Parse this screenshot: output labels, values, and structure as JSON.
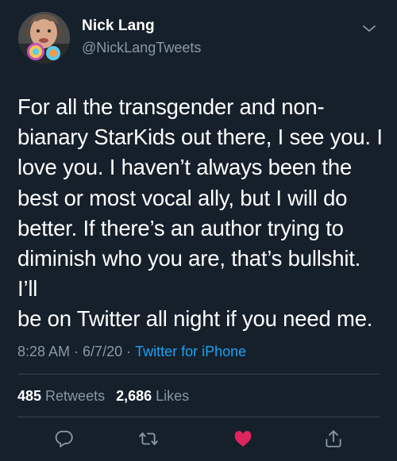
{
  "colors": {
    "background": "#15202b",
    "primary_text": "#ffffff",
    "secondary_text": "#8899a6",
    "accent": "#1da1f2",
    "like": "#e0245e",
    "divider": "#38444d"
  },
  "tweet": {
    "author": {
      "name": "Nick Lang",
      "handle": "@NickLangTweets",
      "avatar_icon": "avatar-photo"
    },
    "menu_icon": "chevron-down-icon",
    "text": "For all the transgender and non-\nbianary StarKids out there, I see you. I\nlove you. I haven’t always been the\nbest or most vocal ally, but I will do\nbetter. If there’s an author trying to\ndiminish who you are, that’s bullshit. I’ll\nbe on Twitter all night if you need me.",
    "time": "8:28 AM",
    "separator": "·",
    "date": "6/7/20",
    "source": "Twitter for iPhone",
    "stats": {
      "retweets_count": "485",
      "retweets_label": "Retweets",
      "likes_count": "2,686",
      "likes_label": "Likes"
    },
    "actions": {
      "reply_icon": "reply-icon",
      "retweet_icon": "retweet-icon",
      "like_icon": "heart-icon",
      "liked": true,
      "share_icon": "share-icon"
    }
  }
}
